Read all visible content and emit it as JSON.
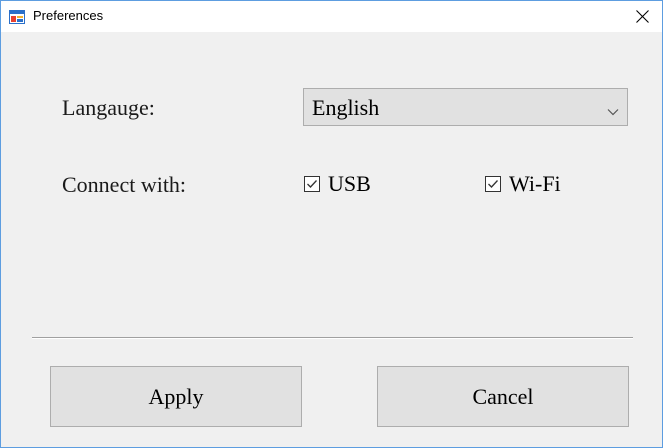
{
  "window": {
    "title": "Preferences",
    "border_color": "#5d9de0",
    "background": "#f0f0f0"
  },
  "icons": {
    "app_icon": "app-form-icon",
    "close_icon": "close-icon",
    "dropdown_icon": "chevron-down-icon",
    "checkbox_icon": "checked-checkbox-icon"
  },
  "form": {
    "language_label": "Langauge:",
    "language_value": "English",
    "connect_label": "Connect with:",
    "options": [
      {
        "label": "USB",
        "checked": true
      },
      {
        "label": "Wi-Fi",
        "checked": true
      }
    ]
  },
  "buttons": {
    "apply": "Apply",
    "cancel": "Cancel"
  }
}
